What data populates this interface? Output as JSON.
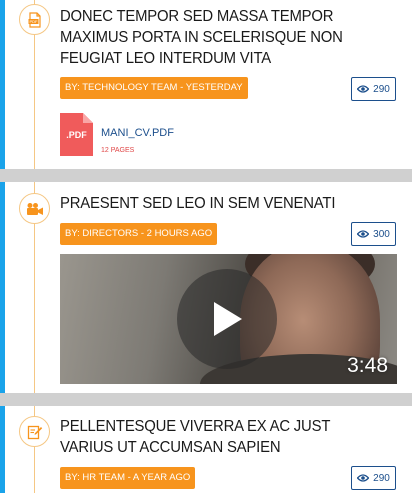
{
  "feed": {
    "items": [
      {
        "type": "pdf",
        "icon": "pdf-file-icon",
        "title": "Donec tempor sed massa tempor maximus porta in scelerisque non feugiat leo interdum vita",
        "meta": "By: Technology Team - Yesterday",
        "views": "290",
        "attachment": {
          "badge": ".PDF",
          "file_name": "MANI_CV.PDF",
          "pages": "12 Pages"
        }
      },
      {
        "type": "video",
        "icon": "video-camera-icon",
        "title": "Praesent sed leo in sem venenati",
        "meta": "By: Directors - 2 hours ago",
        "views": "300",
        "video": {
          "duration": "3:48"
        }
      },
      {
        "type": "post",
        "icon": "edit-icon",
        "title": "Pellentesque viverra ex ac just varius ut accumsan sapien",
        "meta": "By: HR Team - A year ago",
        "views": "290"
      }
    ]
  },
  "colors": {
    "accent_blue": "#1aa3ea",
    "meta_orange": "#f7941d",
    "views_navy": "#1c4f8c",
    "timeline": "#f5c784",
    "pdf_red": "#f05b5b",
    "separator": "#d0d0d0"
  }
}
